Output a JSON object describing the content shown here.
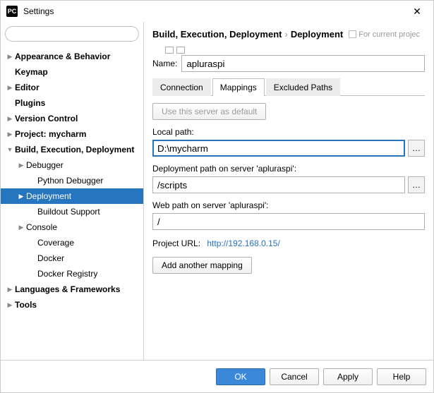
{
  "window": {
    "title": "Settings"
  },
  "search": {
    "placeholder": ""
  },
  "tree": {
    "appearance": "Appearance & Behavior",
    "keymap": "Keymap",
    "editor": "Editor",
    "plugins": "Plugins",
    "version_control": "Version Control",
    "project": "Project: mycharm",
    "bed": "Build, Execution, Deployment",
    "debugger": "Debugger",
    "python_debugger": "Python Debugger",
    "deployment": "Deployment",
    "buildout": "Buildout Support",
    "console": "Console",
    "coverage": "Coverage",
    "docker": "Docker",
    "docker_registry": "Docker Registry",
    "languages": "Languages & Frameworks",
    "tools": "Tools"
  },
  "breadcrumb": {
    "a": "Build, Execution, Deployment",
    "b": "Deployment",
    "scope": "For current projec"
  },
  "name": {
    "label": "Name:",
    "value": "apluraspi"
  },
  "tabs": {
    "connection": "Connection",
    "mappings": "Mappings",
    "excluded": "Excluded Paths"
  },
  "panel": {
    "default_btn": "Use this server as default",
    "local_label": "Local path:",
    "local_value": "D:\\mycharm",
    "deploy_label": "Deployment path on server 'apluraspi':",
    "deploy_value": "/scripts",
    "web_label": "Web path on server 'apluraspi':",
    "web_value": "/",
    "url_label": "Project URL:",
    "url_value": "http://192.168.0.15/",
    "add_mapping": "Add another mapping"
  },
  "footer": {
    "ok": "OK",
    "cancel": "Cancel",
    "apply": "Apply",
    "help": "Help"
  }
}
